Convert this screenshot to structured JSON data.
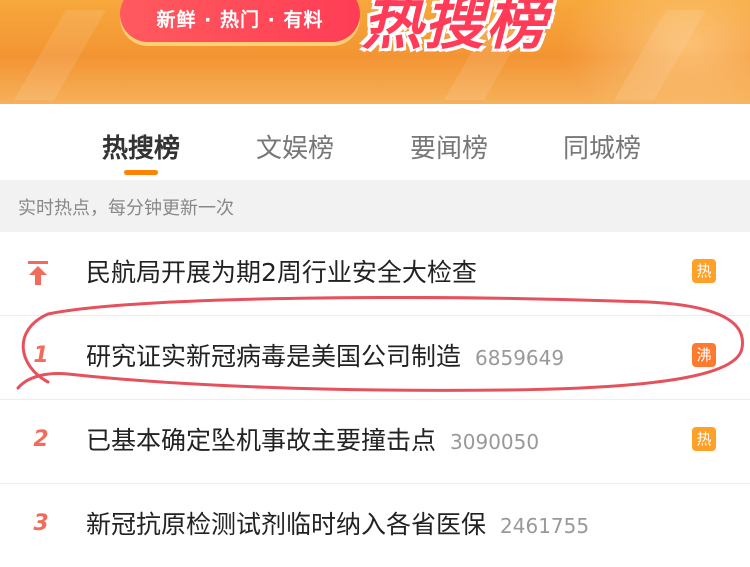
{
  "banner": {
    "tagline": "新鲜 · 热门 · 有料",
    "title": "热搜榜"
  },
  "tabs": [
    {
      "label": "热搜榜",
      "active": true
    },
    {
      "label": "文娱榜",
      "active": false
    },
    {
      "label": "要闻榜",
      "active": false
    },
    {
      "label": "同城榜",
      "active": false
    }
  ],
  "subheader": "实时热点，每分钟更新一次",
  "items": [
    {
      "rank": "",
      "icon": "pin-top-icon",
      "title": "民航局开展为期2周行业安全大检查",
      "count": "",
      "badge": "热"
    },
    {
      "rank": "1",
      "title": "研究证实新冠病毒是美国公司制造",
      "count": "6859649",
      "badge": "沸"
    },
    {
      "rank": "2",
      "title": "已基本确定坠机事故主要撞击点",
      "count": "3090050",
      "badge": "热"
    },
    {
      "rank": "3",
      "title": "新冠抗原检测试剂临时纳入各省医保",
      "count": "2461755",
      "badge": ""
    }
  ],
  "colors": {
    "accent": "#ff8200",
    "rank_red": "#f26b5b",
    "badge_hot": "#ffa129",
    "badge_boil": "#ff7a2f",
    "annotation": "#e0333f"
  }
}
